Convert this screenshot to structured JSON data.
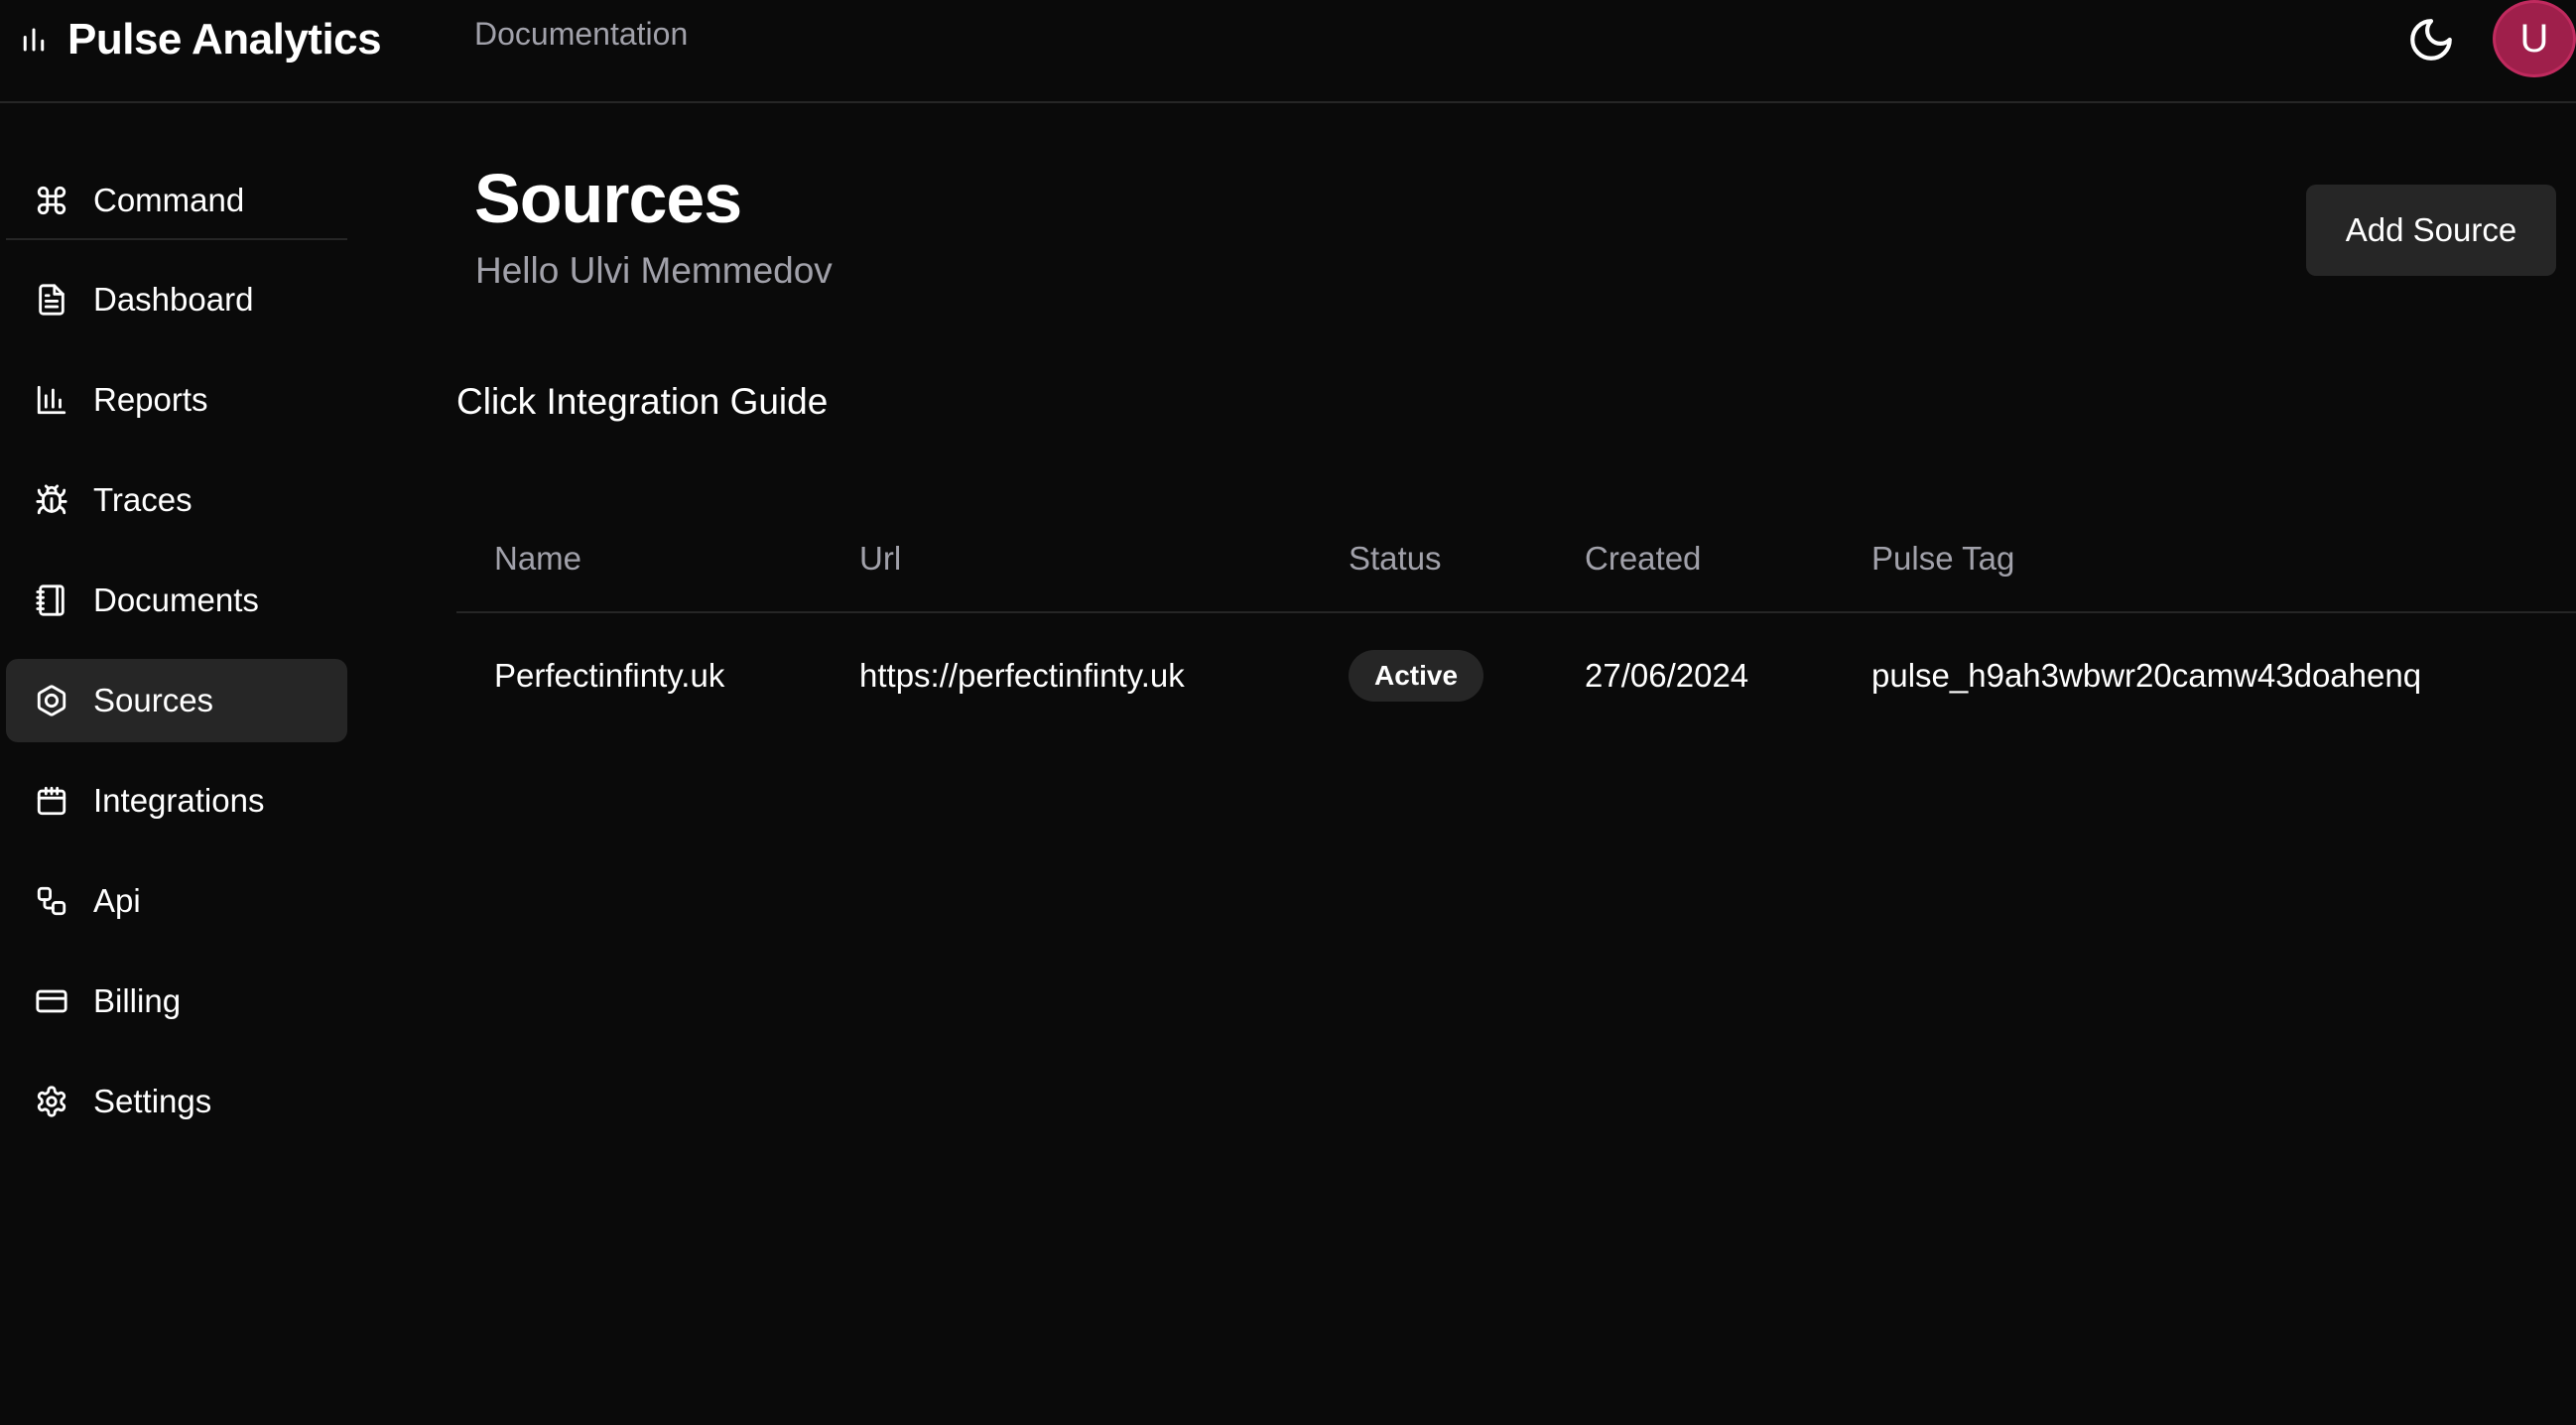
{
  "header": {
    "app_name": "Pulse Analytics",
    "documentation_link": "Documentation",
    "avatar_initial": "U",
    "brand_icon": "bar-chart-icon",
    "theme_icon": "moon-icon",
    "avatar_color": "#9f1f4b"
  },
  "sidebar": {
    "items": [
      {
        "label": "Command",
        "icon": "command-icon"
      },
      {
        "label": "Dashboard",
        "icon": "file-text-icon"
      },
      {
        "label": "Reports",
        "icon": "bar-chart-icon"
      },
      {
        "label": "Traces",
        "icon": "bug-icon"
      },
      {
        "label": "Documents",
        "icon": "notebook-icon"
      },
      {
        "label": "Sources",
        "icon": "hexagon-icon",
        "active": true
      },
      {
        "label": "Integrations",
        "icon": "calendar-icon"
      },
      {
        "label": "Api",
        "icon": "workflow-icon"
      },
      {
        "label": "Billing",
        "icon": "credit-card-icon"
      },
      {
        "label": "Settings",
        "icon": "gear-icon"
      }
    ]
  },
  "main": {
    "title": "Sources",
    "subtitle": "Hello Ulvi Memmedov",
    "add_button": "Add Source",
    "guide_link": "Click Integration Guide",
    "table": {
      "columns": [
        "Name",
        "Url",
        "Status",
        "Created",
        "Pulse Tag"
      ],
      "rows": [
        {
          "name": "Perfectinfinty.uk",
          "url": "https://perfectinfinty.uk",
          "status": "Active",
          "created": "27/06/2024",
          "pulse_tag": "pulse_h9ah3wbwr20camw43doahenq"
        }
      ]
    }
  },
  "colors": {
    "background": "#0a0a0a",
    "active_item": "#262626",
    "muted_text": "#a1a1aa"
  }
}
